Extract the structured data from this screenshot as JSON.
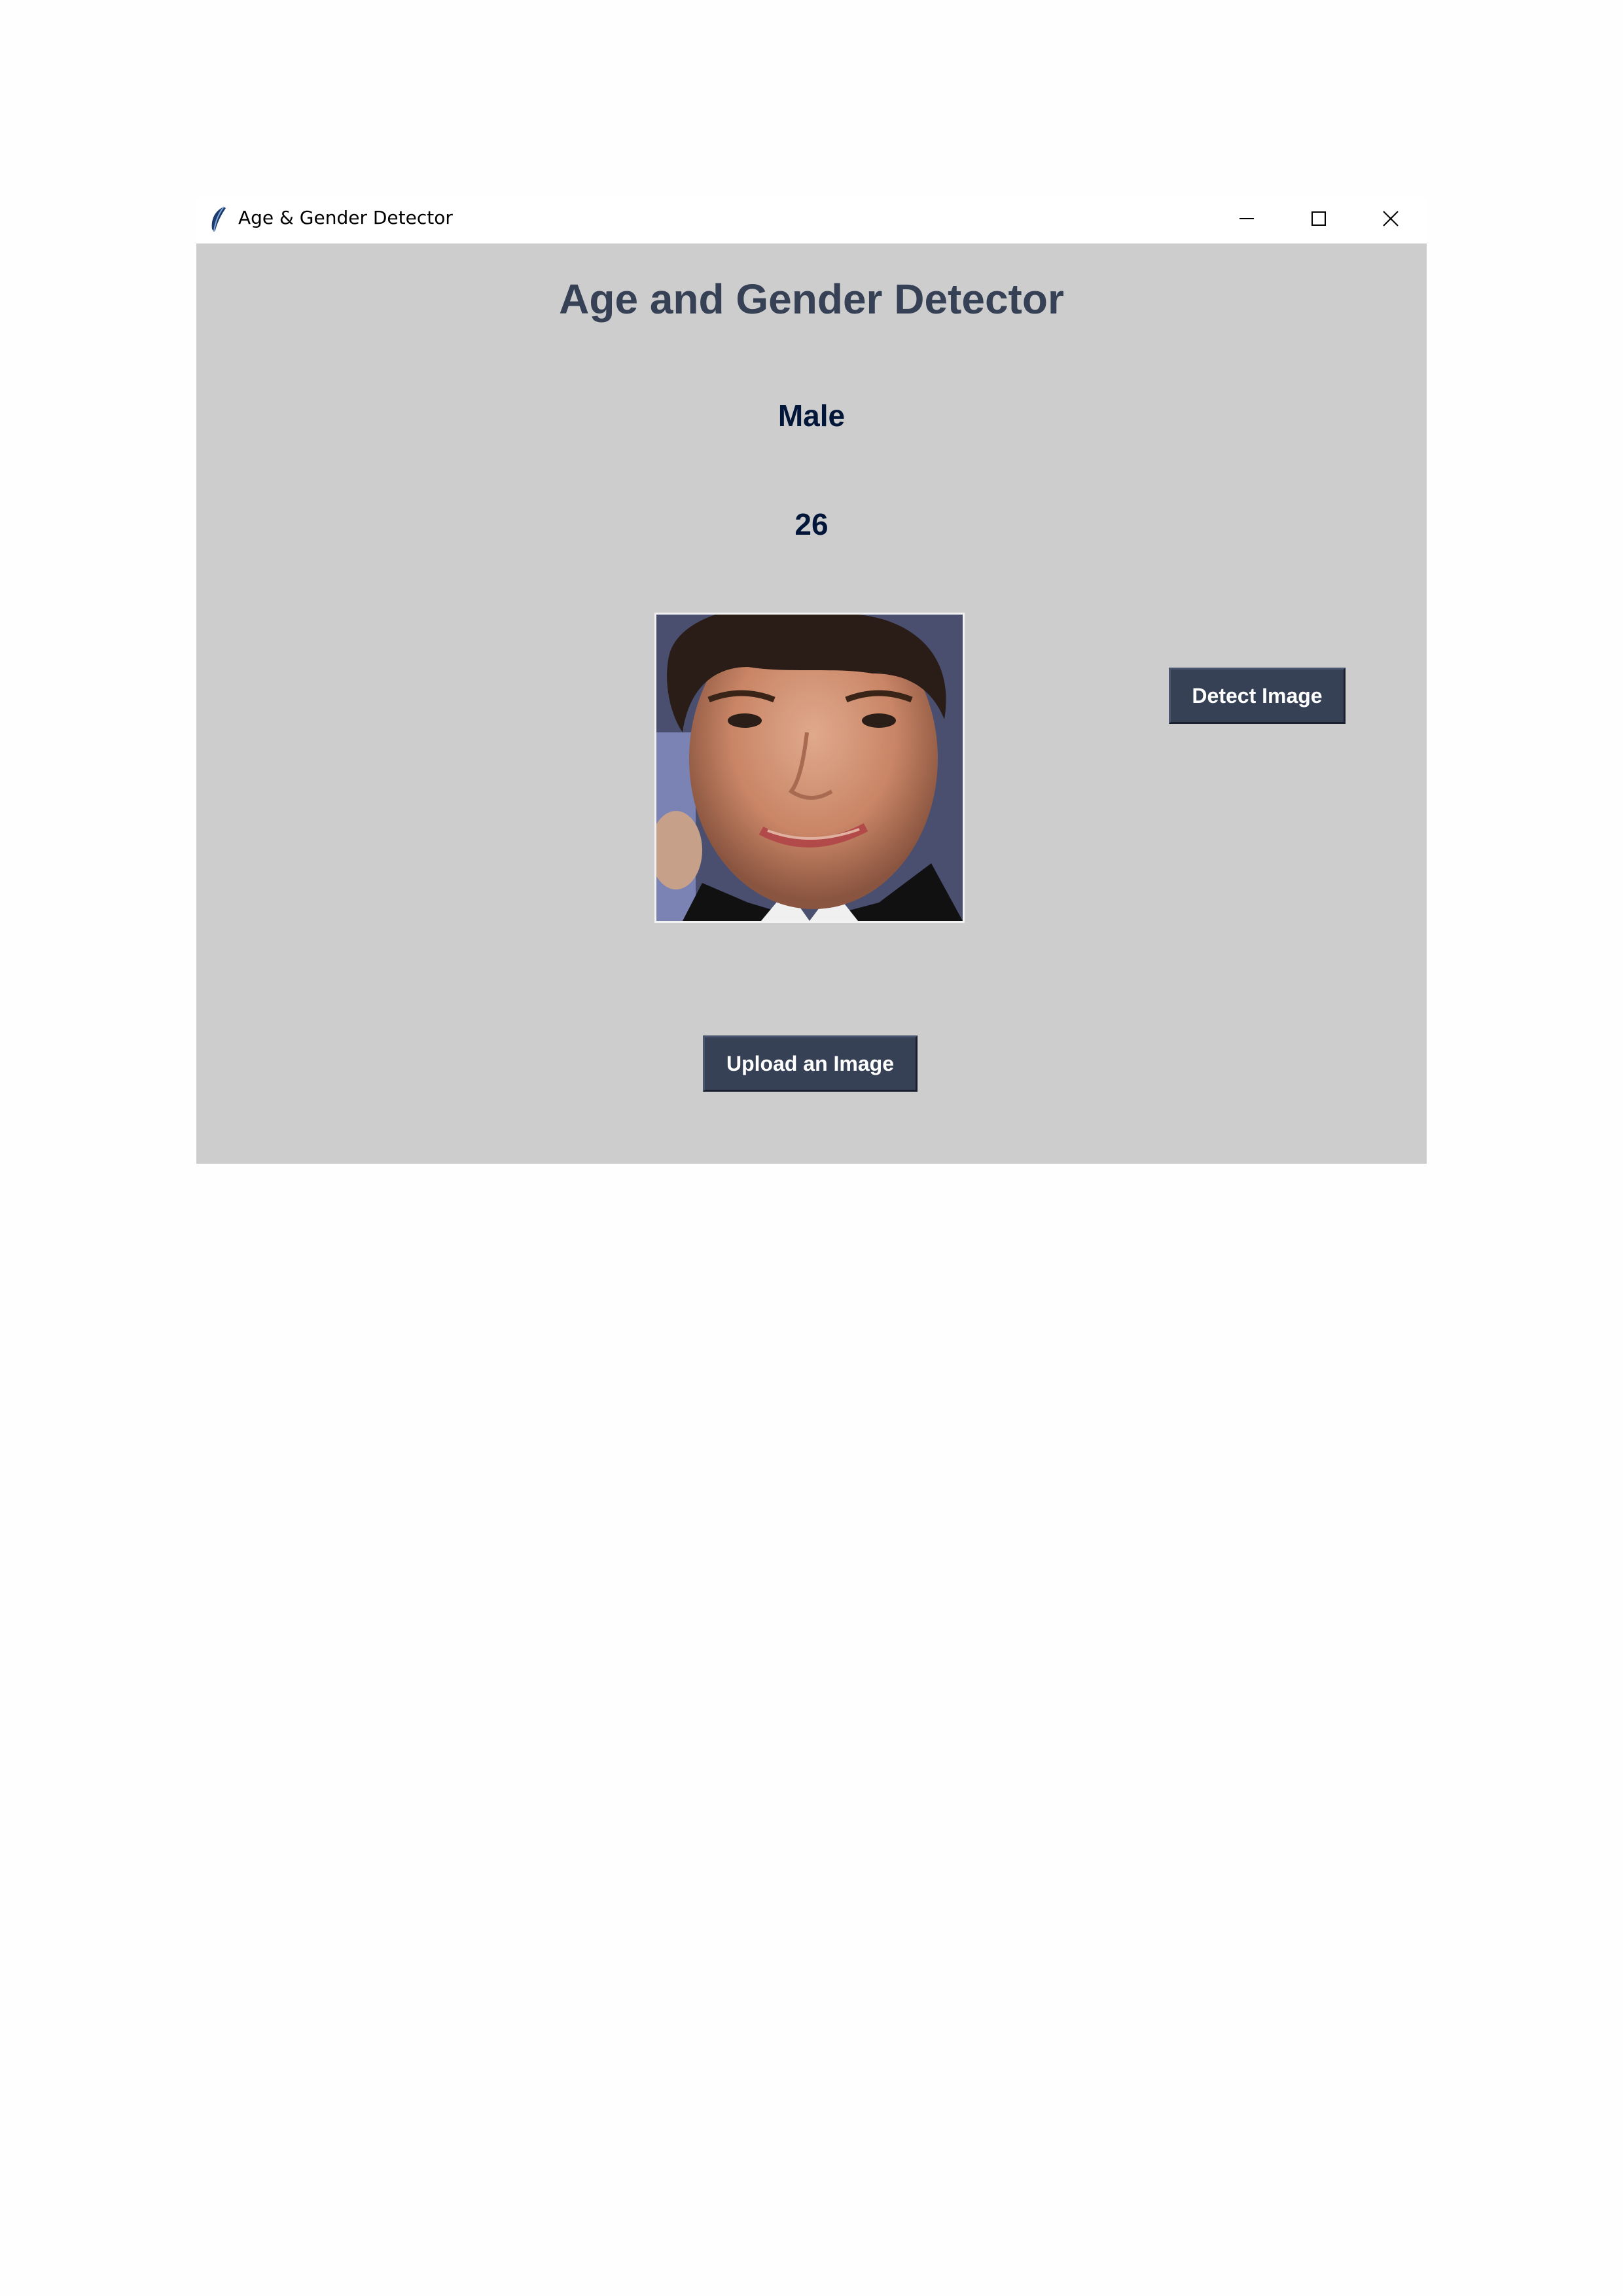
{
  "window": {
    "title": "Age & Gender Detector",
    "icon": "feather-icon",
    "controls": [
      "minimize-icon",
      "maximize-icon",
      "close-icon"
    ]
  },
  "main": {
    "heading": "Age and Gender Detector",
    "gender_result": "Male",
    "age_result": "26",
    "detect_button_label": "Detect Image",
    "upload_button_label": "Upload an Image"
  },
  "colors": {
    "background": "#cdcdcd",
    "heading": "#364156",
    "result_text": "#011638",
    "button_bg": "#364156",
    "button_text": "#ffffff"
  }
}
